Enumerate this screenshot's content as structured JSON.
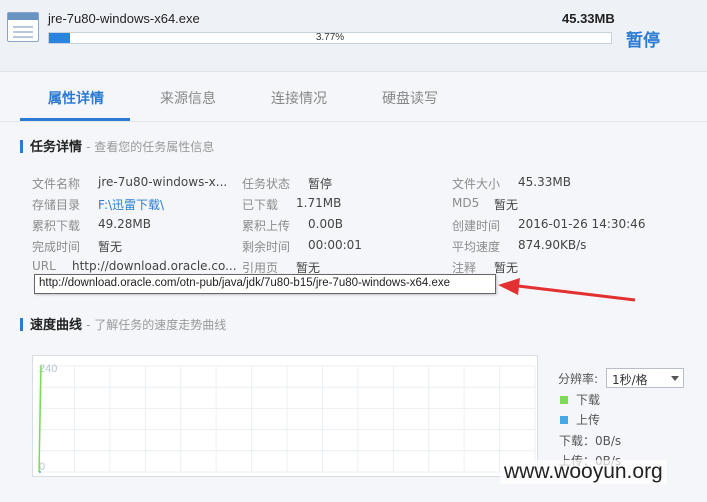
{
  "download": {
    "file_name": "jre-7u80-windows-x64.exe",
    "size": "45.33MB",
    "progress_pct": 3.77,
    "progress_text": "3.77%",
    "pause_label": "暂停"
  },
  "tabs": [
    {
      "label": "属性详情",
      "active": true
    },
    {
      "label": "来源信息",
      "active": false
    },
    {
      "label": "连接情况",
      "active": false
    },
    {
      "label": "硬盘读写",
      "active": false
    }
  ],
  "task_details": {
    "title": "任务详情",
    "subtitle": "- 查看您的任务属性信息",
    "rows": [
      {
        "c1_label": "文件名称",
        "c1_value": "jre-7u80-windows-x...",
        "c2_label": "任务状态",
        "c2_value": "暂停",
        "c3_label": "文件大小",
        "c3_value": "45.33MB"
      },
      {
        "c1_label": "存储目录",
        "c1_value": "F:\\迅雷下载\\",
        "c2_label": "已下载",
        "c2_value": "1.71MB",
        "c3_label": "MD5",
        "c3_value": "暂无"
      },
      {
        "c1_label": "累积下载",
        "c1_value": "49.28MB",
        "c2_label": "累积上传",
        "c2_value": "0.00B",
        "c3_label": "创建时间",
        "c3_value": "2016-01-26 14:30:46"
      },
      {
        "c1_label": "完成时间",
        "c1_value": "暂无",
        "c2_label": "剩余时间",
        "c2_value": "00:00:01",
        "c3_label": "平均速度",
        "c3_value": "874.90KB/s"
      },
      {
        "c1_label": "URL",
        "c1_value": "http://download.oracle.co...",
        "c2_label": "引用页",
        "c2_value": "暂无",
        "c3_label": "注释",
        "c3_value": "暂无"
      }
    ],
    "url_tooltip": "http://download.oracle.com/otn-pub/java/jdk/7u80-b15/jre-7u80-windows-x64.exe"
  },
  "speed_curve": {
    "title": "速度曲线",
    "subtitle": "- 了解任务的速度走势曲线",
    "resolution_label": "分辨率:",
    "resolution_value": "1秒/格",
    "legend_download": "下载",
    "legend_upload": "上传",
    "download_speed": "下载：0B/s",
    "upload_speed": "上传：0B/s",
    "download_color": "#7ed957",
    "upload_color": "#45a9e6"
  },
  "chart_data": {
    "type": "line",
    "ylim": [
      0,
      240
    ],
    "tick_labels": [
      "240",
      "0"
    ],
    "series": [
      {
        "name": "下载",
        "values": [
          0,
          240
        ]
      },
      {
        "name": "上传",
        "values": [
          0,
          0
        ]
      }
    ]
  },
  "watermark": "www.wooyun.org"
}
